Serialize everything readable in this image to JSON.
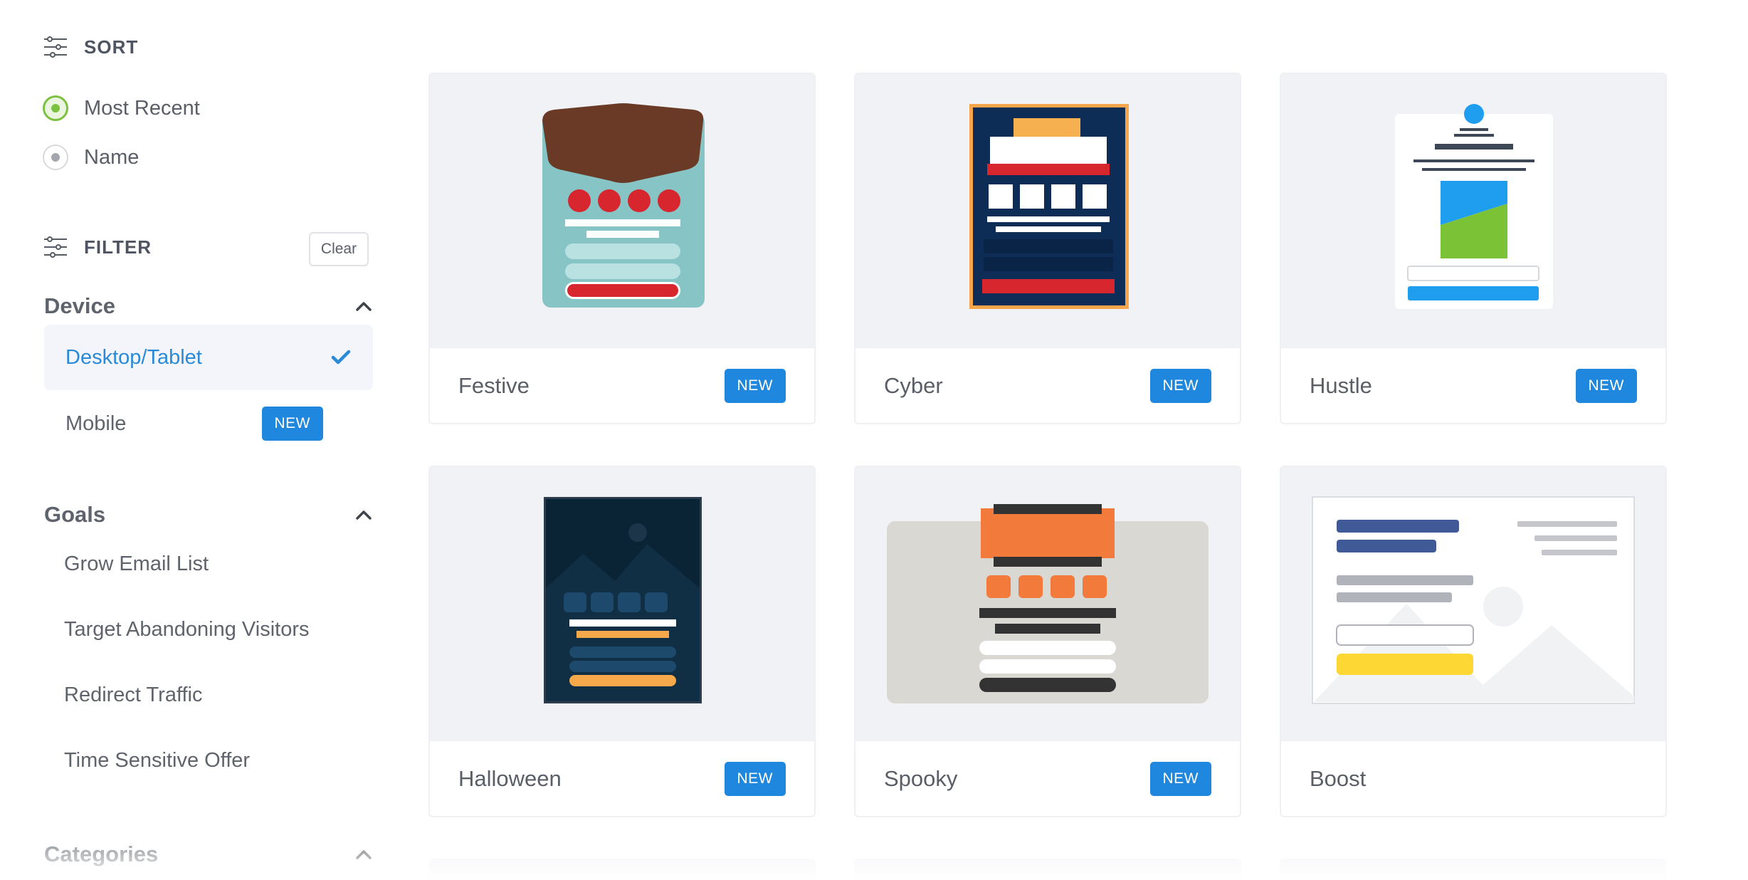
{
  "sort": {
    "title": "SORT",
    "options": [
      {
        "label": "Most Recent",
        "selected": true
      },
      {
        "label": "Name",
        "selected": false
      }
    ]
  },
  "filter": {
    "title": "FILTER",
    "clear_label": "Clear"
  },
  "device": {
    "title": "Device",
    "options": [
      {
        "label": "Desktop/Tablet",
        "selected": true
      },
      {
        "label": "Mobile",
        "badge": "NEW"
      }
    ]
  },
  "goals": {
    "title": "Goals",
    "items": [
      "Grow Email List",
      "Target Abandoning Visitors",
      "Redirect Traffic",
      "Time Sensitive Offer"
    ]
  },
  "categories": {
    "title": "Categories"
  },
  "templates": [
    {
      "name": "Festive",
      "badge": "NEW"
    },
    {
      "name": "Cyber",
      "badge": "NEW"
    },
    {
      "name": "Hustle",
      "badge": "NEW"
    },
    {
      "name": "Halloween",
      "badge": "NEW"
    },
    {
      "name": "Spooky",
      "badge": "NEW"
    },
    {
      "name": "Boost",
      "badge": ""
    }
  ],
  "colors": {
    "accent_blue": "#1f87dd",
    "selected_text": "#2a8ad8",
    "radio_green": "#7dc143",
    "thumb_bg": "#f1f2f6"
  }
}
